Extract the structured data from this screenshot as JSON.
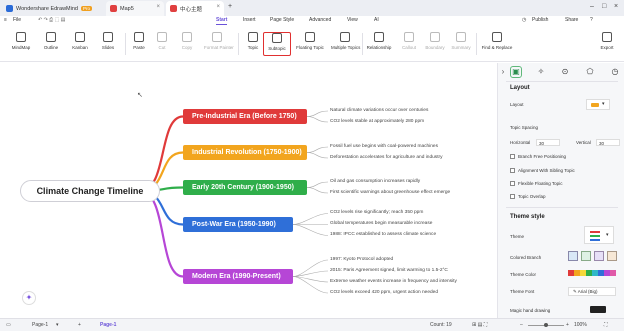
{
  "titlebar": {
    "tabs": [
      {
        "label": "Wondershare EdrawMind",
        "badge": "Pro"
      },
      {
        "label": "Map5"
      },
      {
        "label": "中心主题"
      }
    ],
    "actions": {
      "publish": "Publish",
      "share": "Share"
    }
  },
  "menubar": {
    "file": "File",
    "items": [
      "Start",
      "Insert",
      "Page Style",
      "Advanced",
      "View",
      "AI"
    ],
    "active": "Start"
  },
  "ribbon": {
    "views": [
      "MindMap",
      "Outline",
      "Kanban",
      "Slides"
    ],
    "clipboard": [
      "Paste",
      "Cut",
      "Copy",
      "Format Painter"
    ],
    "insert": [
      "Topic",
      "Subtopic",
      "Floating Topic",
      "Multiple Topics"
    ],
    "relation": [
      "Relationship",
      "Callout",
      "Boundary",
      "Summary"
    ],
    "find": "Find & Replace",
    "export": "Export"
  },
  "map": {
    "central": "Climate Change Timeline",
    "branches": [
      {
        "title": "Pre-Industrial Era (Before 1750)",
        "color": "#e03a3a",
        "subtopics": [
          "Natural climate variations occur over centuries",
          "CO2 levels stable at approximately 280 ppm"
        ]
      },
      {
        "title": "Industrial Revolution (1750-1900)",
        "color": "#f2a51e",
        "subtopics": [
          "Fossil fuel use begins with coal-powered machines",
          "Deforestation accelerates for agriculture and industry"
        ]
      },
      {
        "title": "Early 20th Century (1900-1950)",
        "color": "#2fae4a",
        "subtopics": [
          "Oil and gas consumption increases rapidly",
          "First scientific warnings about greenhouse effect emerge"
        ]
      },
      {
        "title": "Post-War Era (1950-1990)",
        "color": "#2f6fd8",
        "subtopics": [
          "CO2 levels rise significantly; reach 350 ppm",
          "Global temperatures begin measurable increase",
          "1988: IPCC established to assess climate science"
        ]
      },
      {
        "title": "Modern Era (1990-Present)",
        "color": "#b646d6",
        "subtopics": [
          "1997: Kyoto Protocol adopted",
          "2015: Paris Agreement signed, limit warming to 1.5-2°C",
          "Extreme weather events increase in frequency and intensity",
          "CO2 levels exceed 420 ppm, urgent action needed"
        ]
      }
    ]
  },
  "panel": {
    "layout_title": "Layout",
    "layout_label": "Layout",
    "topic_spacing": "Topic Spacing",
    "horizontal_label": "Horizontal",
    "horizontal_value": "30",
    "vertical_label": "Vertical",
    "vertical_value": "30",
    "options": [
      "Branch Free Positioning",
      "Alignment With Sibling Topic",
      "Flexible Floating Topic",
      "Topic Overlap"
    ],
    "theme_title": "Theme style",
    "theme_label": "Theme",
    "colored_branch": "Colored Branch",
    "theme_color": "Theme Color",
    "theme_font": "Theme Font",
    "theme_font_value": "Arial (Big)",
    "hand_drawing": "Magic hand drawing"
  },
  "status": {
    "page_dropdown": "Page-1",
    "page_tab": "Page-1",
    "count": "Count: 19",
    "zoom": "100%"
  }
}
